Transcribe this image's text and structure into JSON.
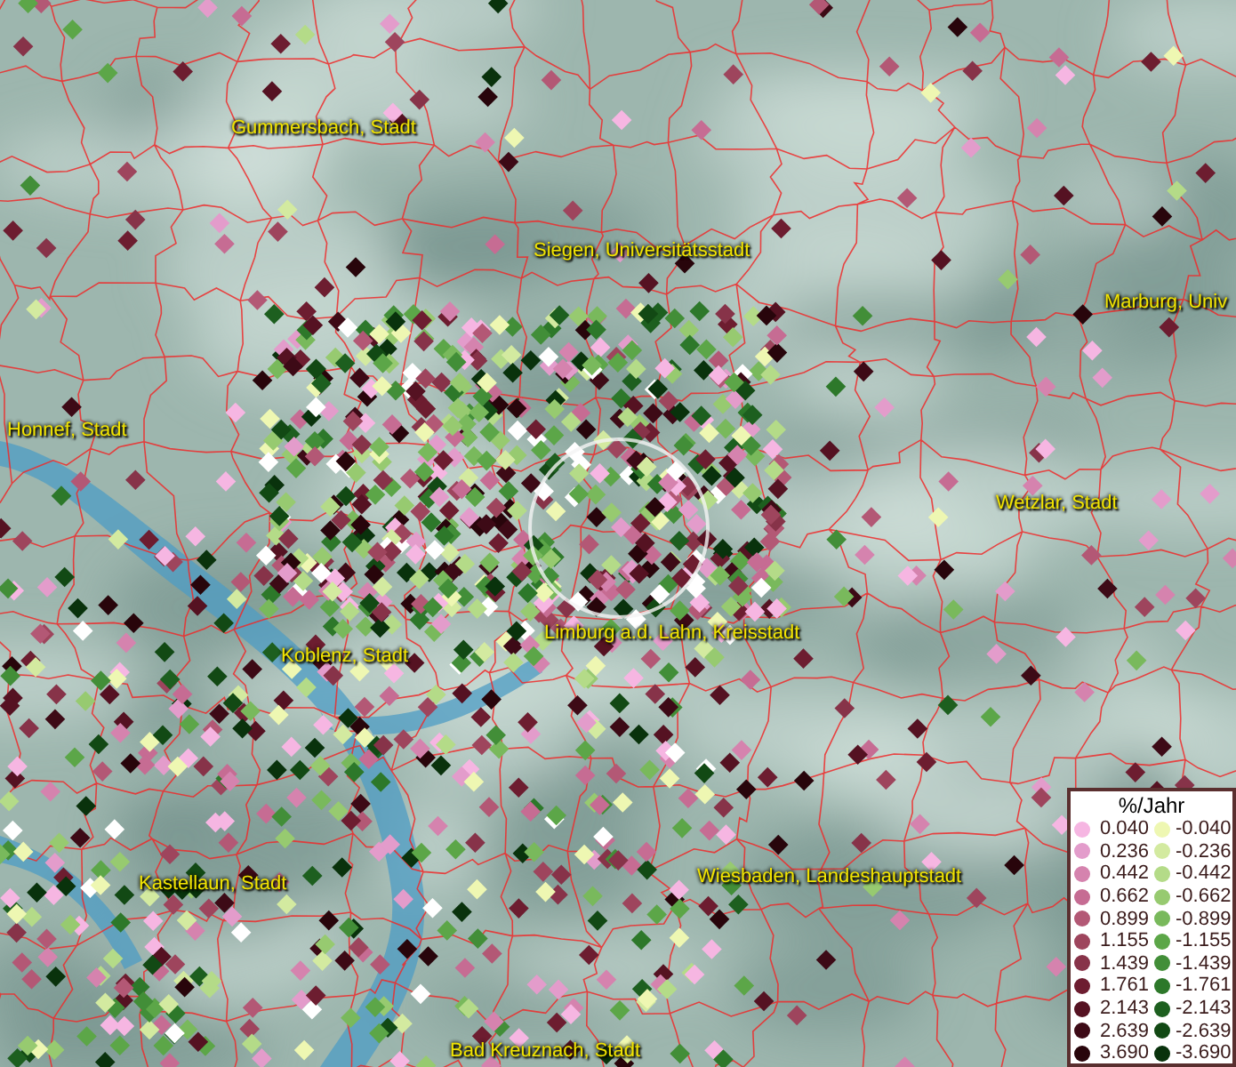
{
  "map": {
    "labels": [
      {
        "text": "Gummersbach, Stadt"
      },
      {
        "text": "Siegen, Universitätsstadt"
      },
      {
        "text": "Marburg, Univ"
      },
      {
        "text": "Honnef, Stadt"
      },
      {
        "text": "Wetzlar, Stadt"
      },
      {
        "text": "Limburg a.d. Lahn, Kreisstadt"
      },
      {
        "text": "Koblenz, Stadt"
      },
      {
        "text": "Kastellaun, Stadt"
      },
      {
        "text": "Wiesbaden, Landeshauptstadt"
      },
      {
        "text": "Bad Kreuznach, Stadt"
      }
    ]
  },
  "legend": {
    "title": "%/Jahr",
    "positive": [
      {
        "value": "0.040",
        "color": "#f6b6e2"
      },
      {
        "value": "0.236",
        "color": "#e39ccb"
      },
      {
        "value": "0.442",
        "color": "#d583ae"
      },
      {
        "value": "0.662",
        "color": "#c66c93"
      },
      {
        "value": "0.899",
        "color": "#b35875"
      },
      {
        "value": "1.155",
        "color": "#9e455d"
      },
      {
        "value": "1.439",
        "color": "#873349"
      },
      {
        "value": "1.761",
        "color": "#6d1d30"
      },
      {
        "value": "2.143",
        "color": "#551222"
      },
      {
        "value": "2.639",
        "color": "#3d0a16"
      },
      {
        "value": "3.690",
        "color": "#28050b"
      }
    ],
    "negative": [
      {
        "value": "-0.040",
        "color": "#eef7b2"
      },
      {
        "value": "-0.236",
        "color": "#d3eaa0"
      },
      {
        "value": "-0.442",
        "color": "#b4db88"
      },
      {
        "value": "-0.662",
        "color": "#97ca70"
      },
      {
        "value": "-0.899",
        "color": "#79b95c"
      },
      {
        "value": "-1.155",
        "color": "#5ca648"
      },
      {
        "value": "-1.439",
        "color": "#428e38"
      },
      {
        "value": "-1.761",
        "color": "#2d782a"
      },
      {
        "value": "-2.143",
        "color": "#1d5f1f"
      },
      {
        "value": "-2.639",
        "color": "#124914"
      },
      {
        "value": "-3.690",
        "color": "#09320c"
      }
    ]
  }
}
